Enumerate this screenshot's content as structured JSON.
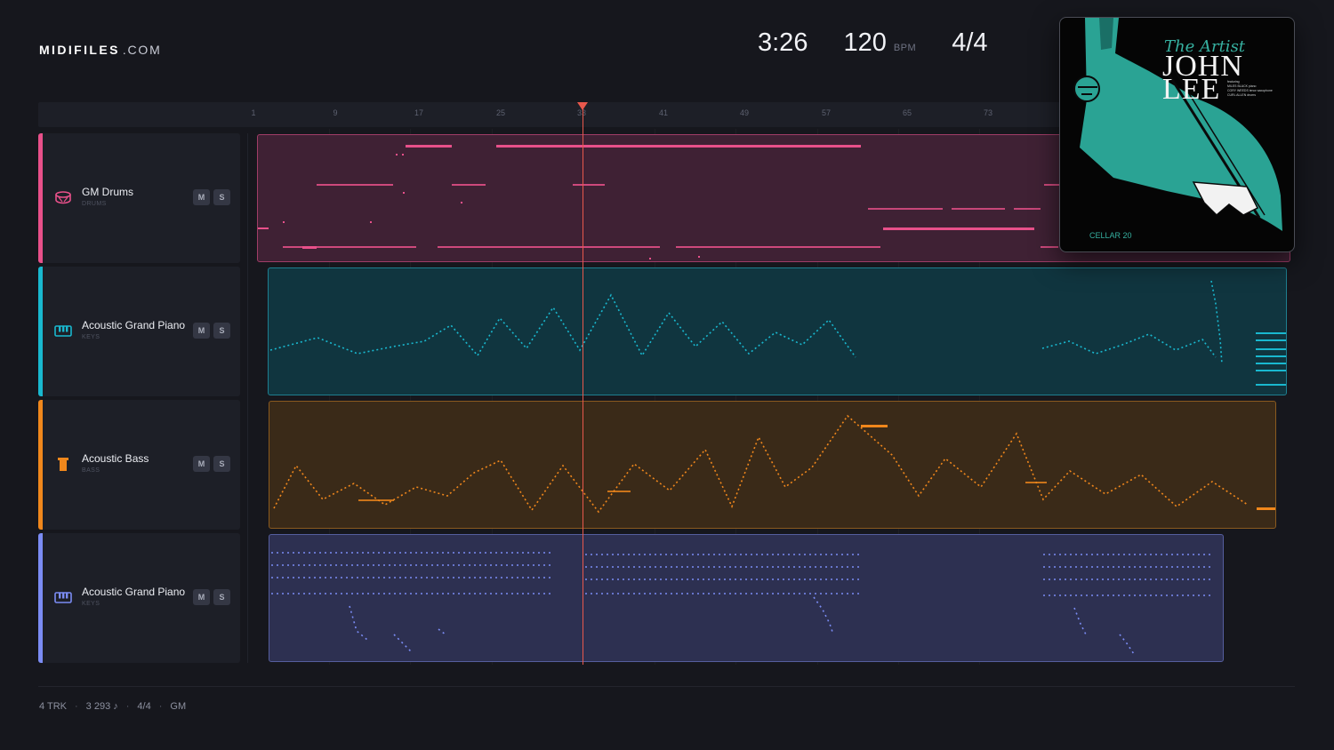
{
  "brand": {
    "name": "MIDIFILES",
    "tld": ".COM"
  },
  "transport": {
    "time": "3:26",
    "tempo": "120",
    "tempo_unit": "BPM",
    "signature": "4/4"
  },
  "ruler": {
    "ticks": [
      "1",
      "9",
      "17",
      "25",
      "33",
      "41",
      "49",
      "57",
      "65",
      "73"
    ],
    "playhead_label": "33"
  },
  "tracks": [
    {
      "name": "GM Drums",
      "category": "DRUMS",
      "icon": "drum-icon",
      "color": "#e8508a",
      "mute_label": "M",
      "solo_label": "S"
    },
    {
      "name": "Acoustic Grand Piano",
      "category": "KEYS",
      "icon": "piano-icon",
      "color": "#19b8cf",
      "mute_label": "M",
      "solo_label": "S"
    },
    {
      "name": "Acoustic Bass",
      "category": "BASS",
      "icon": "bass-icon",
      "color": "#f0871c",
      "mute_label": "M",
      "solo_label": "S"
    },
    {
      "name": "Acoustic Grand Piano",
      "category": "KEYS",
      "icon": "piano-icon",
      "color": "#7b8cf4",
      "mute_label": "M",
      "solo_label": "S"
    }
  ],
  "album": {
    "script_title": "The Artist",
    "artist_first": "JOHN",
    "artist_last": "LEE",
    "credits": "featuring\nMILES BLACK piano\nCORY WEEDS tenor saxophone\nCURL ALLEN drums",
    "badge": "CELLAR 20",
    "colors": {
      "accent": "#36b0a0",
      "background": "#050505"
    }
  },
  "footer": {
    "tracks": "4 TRK",
    "notes": "3 293 ♪",
    "signature": "4/4",
    "standard": "GM"
  }
}
